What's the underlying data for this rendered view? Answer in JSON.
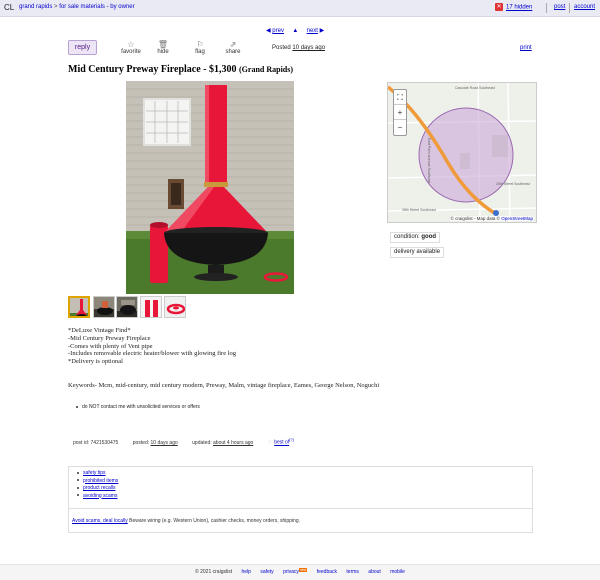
{
  "header": {
    "logo": "CL",
    "crumb_city": "grand rapids",
    "crumb_sep": ">",
    "crumb_category": "for sale materials - by owner",
    "hidden_label": "17 hidden",
    "post_label": "post",
    "account_label": "account"
  },
  "nav": {
    "prev": "prev",
    "up": "▲",
    "next": "next"
  },
  "actions": {
    "reply": "reply",
    "favorite": "favorite",
    "hide": "hide",
    "flag": "flag",
    "share": "share",
    "posted_prefix": "Posted",
    "posted_ago": "10 days ago",
    "print": "print"
  },
  "listing": {
    "title": "Mid Century Preway Fireplace - $1,300",
    "location": "(Grand Rapids)",
    "condition_label": "condition:",
    "condition_value": "good",
    "delivery": "delivery available"
  },
  "map": {
    "zoom_in": "+",
    "zoom_out": "−",
    "fullscreen": "⛶",
    "attribution_prefix": "© craigslist - Map data ©",
    "attribution_link": "OpenStreetMap",
    "road1": "Cascade Road Southeast",
    "road2": "28th Street Southeast",
    "road3": "28th Street Southeast",
    "road4": "East Paris Avenue Southeast"
  },
  "description": {
    "lines": [
      "*DeLuxe Vintage Find*",
      "-Mid Century Preway Fireplace",
      "-Comes with plenty of Vent pipe",
      "-Includes removable electric heater/blower with glowing fire log",
      "*Delivery is optional"
    ],
    "keywords": "Keywords- Mcm, mid-century, mid century modern, Preway, Malm, vintage fireplace, Eames, George Nelson, Noguchi",
    "notice": "do NOT contact me with unsolicited services or offers"
  },
  "postinfo": {
    "post_id": "post id: 7421530475",
    "posted_label": "posted:",
    "posted_value": "10 days ago",
    "updated_label": "updated:",
    "updated_value": "about 4 hours ago",
    "best_of": "best of"
  },
  "safety": {
    "links": [
      "safety tips",
      "prohibited items",
      "product recalls",
      "avoiding scams"
    ],
    "scam_link": "Avoid scams, deal locally",
    "scam_text": "Beware wiring (e.g. Western Union), cashier checks, money orders, shipping."
  },
  "footer": {
    "copyright": "© 2021 craigslist",
    "help": "help",
    "safety": "safety",
    "privacy": "privacy",
    "new_badge": "new",
    "feedback": "feedback",
    "terms": "terms",
    "about": "about",
    "mobile": "mobile"
  },
  "colors": {
    "header_bg": "#eaeaf5",
    "link": "#0000cc",
    "reply_bg": "#ede4f5",
    "fireplace_red": "#e8173a",
    "map_circle": "#c8a2d6",
    "map_road": "#f09a3a"
  }
}
